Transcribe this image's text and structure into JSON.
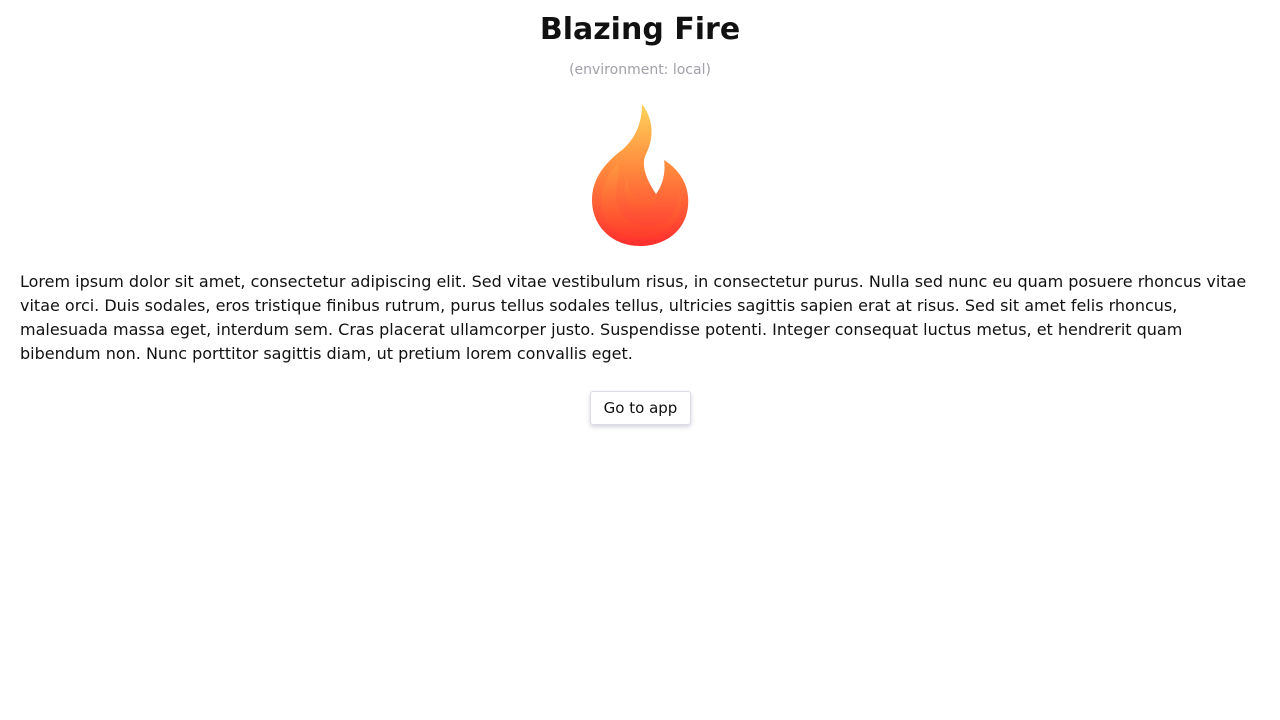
{
  "header": {
    "title": "Blazing Fire",
    "environment_label": "(environment: local)"
  },
  "logo": {
    "icon": "flame-icon",
    "colors": {
      "top": "#ffd35a",
      "mid": "#ff8a3d",
      "bottom": "#ff2e2e"
    }
  },
  "content": {
    "paragraph": "Lorem ipsum dolor sit amet, consectetur adipiscing elit. Sed vitae vestibulum risus, in consectetur purus. Nulla sed nunc eu quam posuere rhoncus vitae vitae orci. Duis sodales, eros tristique finibus rutrum, purus tellus sodales tellus, ultricies sagittis sapien erat at risus. Sed sit amet felis rhoncus, malesuada massa eget, interdum sem. Cras placerat ullamcorper justo. Suspendisse potenti. Integer consequat luctus metus, et hendrerit quam bibendum non. Nunc porttitor sagittis diam, ut pretium lorem convallis eget."
  },
  "actions": {
    "go_to_app_label": "Go to app"
  }
}
